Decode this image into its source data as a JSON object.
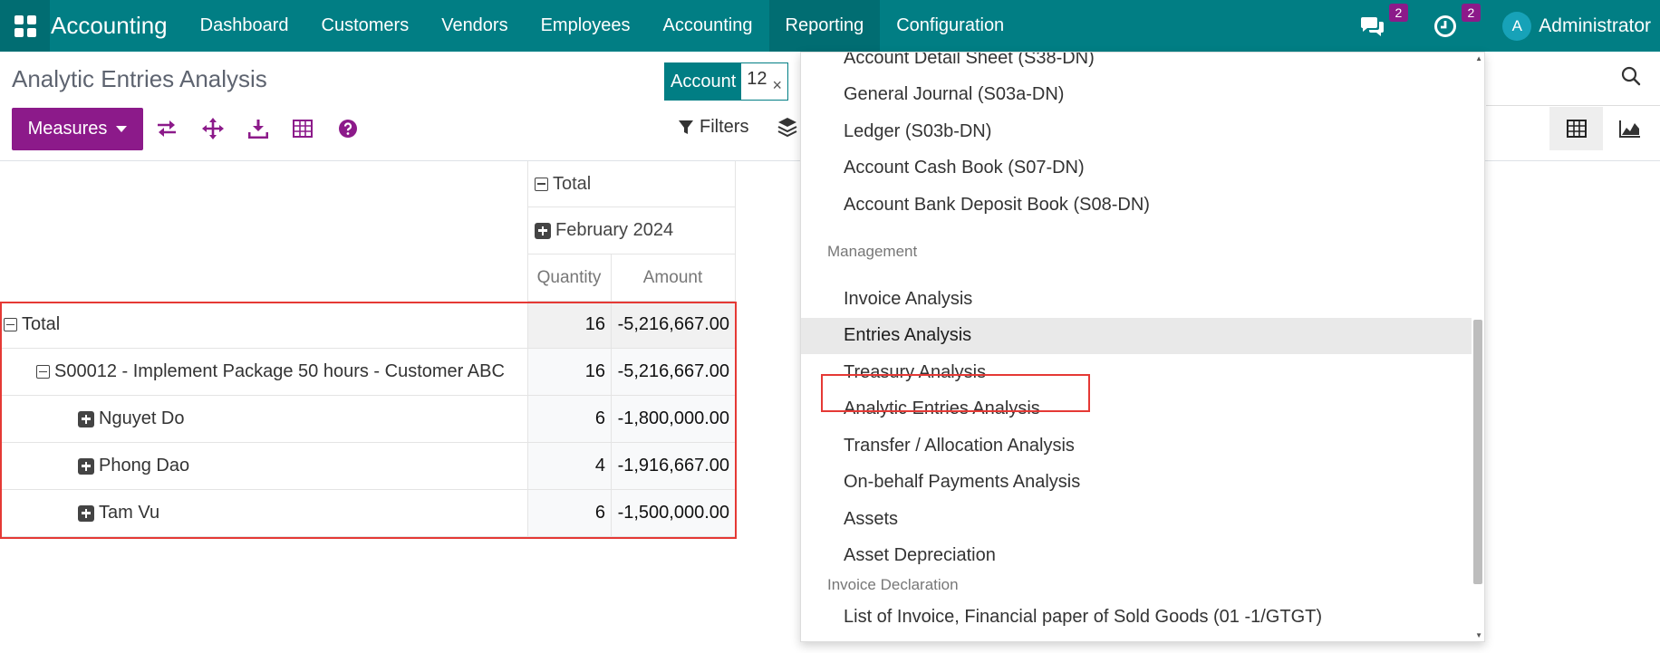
{
  "app": {
    "brand": "Accounting"
  },
  "nav": {
    "menu": [
      "Dashboard",
      "Customers",
      "Vendors",
      "Employees",
      "Accounting",
      "Reporting",
      "Configuration"
    ],
    "active": "Reporting",
    "messages_count": "2",
    "activities_count": "2",
    "avatar_initial": "A",
    "user_name": "Administrator"
  },
  "control_panel": {
    "title": "Analytic Entries Analysis",
    "facet_label": "Account",
    "facet_value": "12",
    "facet_close": "×",
    "measures_label": "Measures",
    "filters_label": "Filters"
  },
  "pivot": {
    "col_header_total": "Total",
    "col_header_period": "February 2024",
    "measures": [
      "Quantity",
      "Amount"
    ],
    "rows": [
      {
        "label": "Total",
        "quantity": "16",
        "amount": "-5,216,667.00",
        "level": 0,
        "icon": "minus"
      },
      {
        "label": "S00012 - Implement Package 50 hours - Customer ABC",
        "quantity": "16",
        "amount": "-5,216,667.00",
        "level": 1,
        "icon": "minus"
      },
      {
        "label": "Nguyet Do",
        "quantity": "6",
        "amount": "-1,800,000.00",
        "level": 2,
        "icon": "plus"
      },
      {
        "label": "Phong Dao",
        "quantity": "4",
        "amount": "-1,916,667.00",
        "level": 2,
        "icon": "plus"
      },
      {
        "label": "Tam Vu",
        "quantity": "6",
        "amount": "-1,500,000.00",
        "level": 2,
        "icon": "plus"
      }
    ]
  },
  "reporting_menu": {
    "items_top": [
      "Account Detail Sheet (S38-DN)",
      "General Journal (S03a-DN)",
      "Ledger (S03b-DN)",
      "Account Cash Book (S07-DN)",
      "Account Bank Deposit Book (S08-DN)"
    ],
    "section_management": "Management",
    "items_management": [
      "Invoice Analysis",
      "Entries Analysis",
      "Treasury Analysis",
      "Analytic Entries Analysis",
      "Transfer / Allocation Analysis",
      "On-behalf Payments Analysis",
      "Assets",
      "Asset Depreciation"
    ],
    "hovered_item": "Entries Analysis",
    "highlighted_item": "Analytic Entries Analysis",
    "section_invoice": "Invoice Declaration",
    "items_invoice": [
      "List of Invoice, Financial paper of Sold Goods (01 -1/GTGT)"
    ]
  },
  "colors": {
    "nav_bg": "#017e84",
    "primary_button": "#8c1a8a",
    "highlight_border": "#e53935"
  },
  "icons": {
    "apps": "apps-grid-icon",
    "messages": "chat-icon",
    "activities": "clock-icon",
    "search": "search-icon",
    "flip_axis": "flip-axis-icon",
    "expand_all": "expand-all-icon",
    "download": "download-icon",
    "grid": "table-icon",
    "help": "help-icon",
    "filter": "filter-icon",
    "group": "layers-icon",
    "pivot_view": "pivot-view-icon",
    "graph_view": "graph-view-icon"
  }
}
